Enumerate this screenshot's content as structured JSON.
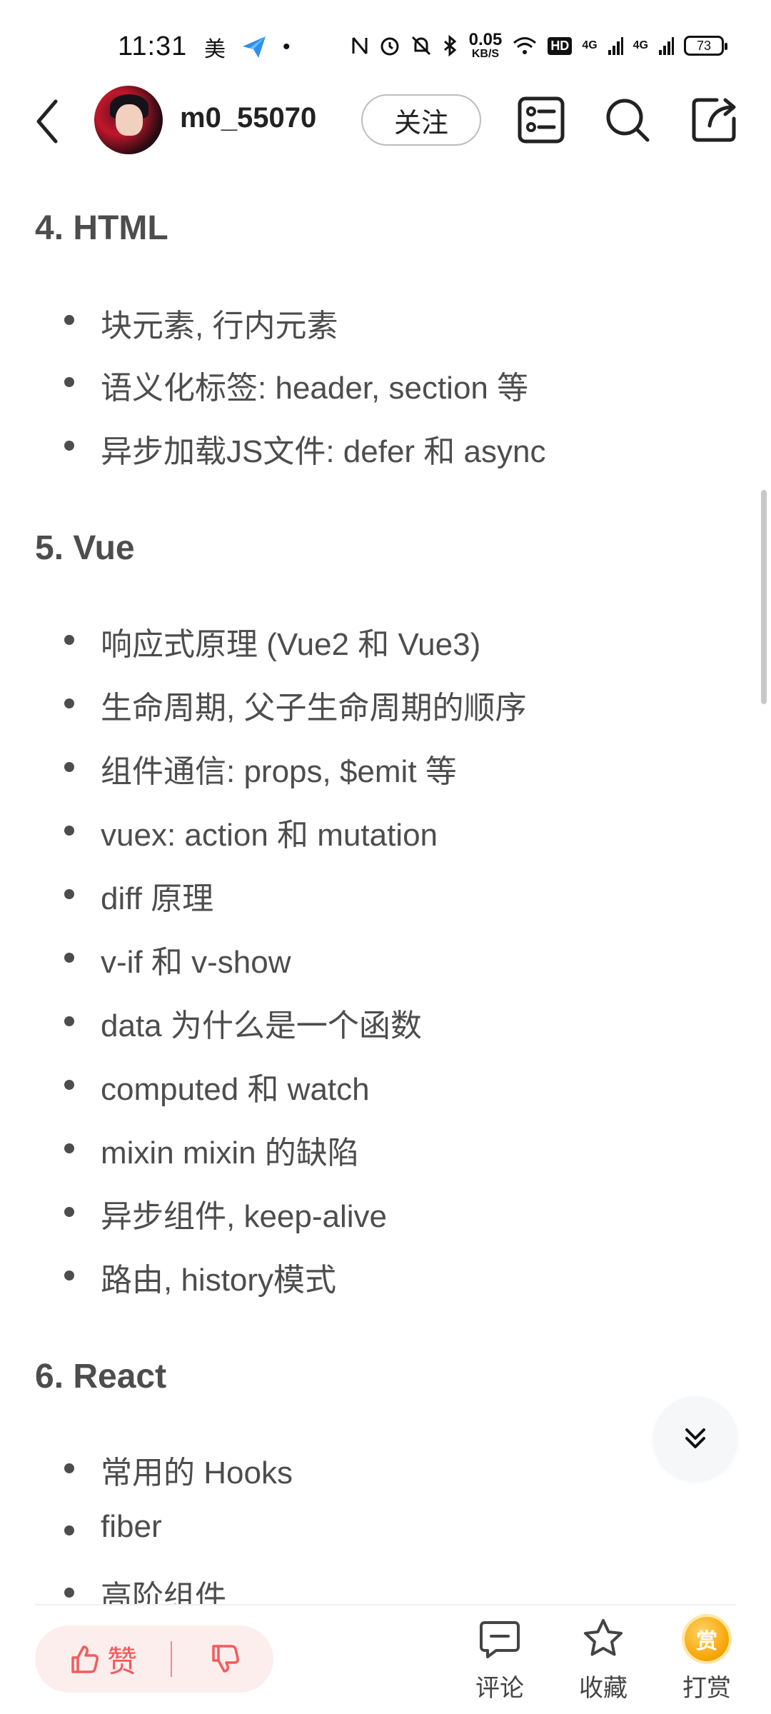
{
  "status_bar": {
    "time": "11:31",
    "left_icons": [
      "美",
      "paper-plane-icon",
      "•"
    ],
    "net_speed_value": "0.05",
    "net_speed_unit": "KB/S",
    "hd_badge": "HD",
    "sig1": "4G",
    "sig2": "4G",
    "battery": "73"
  },
  "header": {
    "username": "m0_55070",
    "follow_label": "关注"
  },
  "sections": [
    {
      "title": "4. HTML",
      "items": [
        "块元素, 行内元素",
        "语义化标签: header, section 等",
        "异步加载JS文件: defer 和 async"
      ]
    },
    {
      "title": "5. Vue",
      "items": [
        "响应式原理 (Vue2 和 Vue3)",
        "生命周期, 父子生命周期的顺序",
        "组件通信: props, $emit 等",
        "vuex: action 和 mutation",
        "diff 原理",
        "v-if 和 v-show",
        "data 为什么是一个函数",
        "computed 和 watch",
        "mixin mixin 的缺陷",
        "异步组件, keep-alive",
        "路由, history模式"
      ]
    },
    {
      "title": "6. React",
      "items": [
        "常用的 Hooks",
        "fiber",
        "高阶组件"
      ]
    }
  ],
  "bottom_bar": {
    "like_label": "赞",
    "comment_label": "评论",
    "favorite_label": "收藏",
    "reward_label": "打赏",
    "reward_coin_text": "赏"
  },
  "colors": {
    "text": "#4d4d4d",
    "like": "#f45b5b",
    "like_bg": "#fdeeee",
    "reward": "#f7a300"
  }
}
